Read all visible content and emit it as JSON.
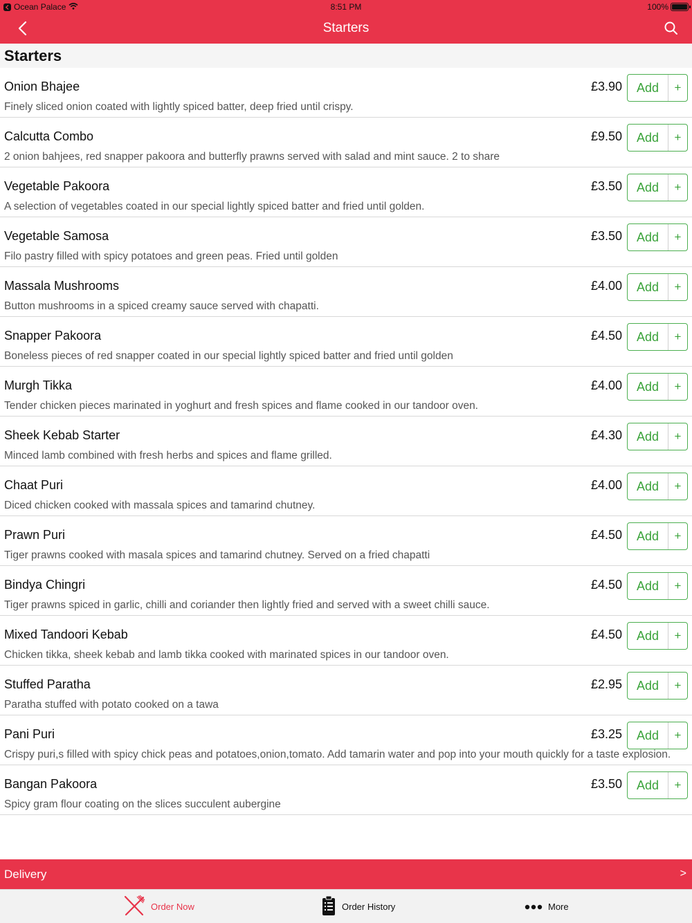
{
  "status_bar": {
    "carrier": "Ocean Palace",
    "time": "8:51 PM",
    "battery": "100%"
  },
  "nav": {
    "title": "Starters"
  },
  "section": {
    "title": "Starters"
  },
  "add_label": "Add",
  "add_plus": "+",
  "items": [
    {
      "name": "Onion Bhajee",
      "price": "£3.90",
      "description": "Finely sliced onion coated with lightly spiced batter, deep fried until crispy."
    },
    {
      "name": "Calcutta Combo",
      "price": "£9.50",
      "description": "2 onion bahjees, red snapper pakoora and butterfly prawns served with salad and mint sauce. 2 to share"
    },
    {
      "name": "Vegetable Pakoora",
      "price": "£3.50",
      "description": "A selection of vegetables coated in our special lightly spiced batter and fried until golden."
    },
    {
      "name": "Vegetable Samosa",
      "price": "£3.50",
      "description": "Filo pastry filled with spicy potatoes and green peas. Fried until golden"
    },
    {
      "name": "Massala Mushrooms",
      "price": "£4.00",
      "description": "Button mushrooms in a spiced creamy sauce served with chapatti."
    },
    {
      "name": "Snapper Pakoora",
      "price": "£4.50",
      "description": "Boneless pieces of red snapper coated in our special lightly spiced batter and fried until golden"
    },
    {
      "name": "Murgh Tikka",
      "price": "£4.00",
      "description": "Tender chicken pieces marinated in yoghurt and fresh spices and flame cooked in our tandoor oven."
    },
    {
      "name": "Sheek Kebab Starter",
      "price": "£4.30",
      "description": "Minced lamb combined with fresh herbs and spices and flame grilled."
    },
    {
      "name": "Chaat Puri",
      "price": "£4.00",
      "description": "Diced chicken cooked with massala spices and tamarind chutney."
    },
    {
      "name": "Prawn Puri",
      "price": "£4.50",
      "description": "Tiger prawns cooked with masala spices and tamarind chutney. Served on a fried chapatti"
    },
    {
      "name": "Bindya Chingri",
      "price": "£4.50",
      "description": "Tiger prawns spiced in garlic, chilli and coriander then lightly fried and served with a sweet chilli sauce."
    },
    {
      "name": "Mixed Tandoori Kebab",
      "price": "£4.50",
      "description": "Chicken tikka, sheek kebab and lamb tikka cooked with marinated spices in our tandoor oven."
    },
    {
      "name": "Stuffed Paratha",
      "price": "£2.95",
      "description": "Paratha stuffed with potato cooked on a tawa"
    },
    {
      "name": "Pani Puri",
      "price": "£3.25",
      "description": "Crispy puri,s filled with spicy chick peas and potatoes,onion,tomato. Add tamarin water and pop into your mouth quickly for a taste explosion."
    },
    {
      "name": "Bangan Pakoora",
      "price": "£3.50",
      "description": "Spicy gram flour coating on the slices succulent aubergine"
    }
  ],
  "delivery": {
    "label": "Delivery",
    "arrow": ">"
  },
  "tabs": [
    {
      "label": "Order Now",
      "icon": "fork-knife-icon"
    },
    {
      "label": "Order History",
      "icon": "clipboard-icon"
    },
    {
      "label": "More",
      "icon": "more-dots-icon"
    }
  ],
  "colors": {
    "accent": "#e8344a",
    "add_green": "#3aa33a"
  }
}
